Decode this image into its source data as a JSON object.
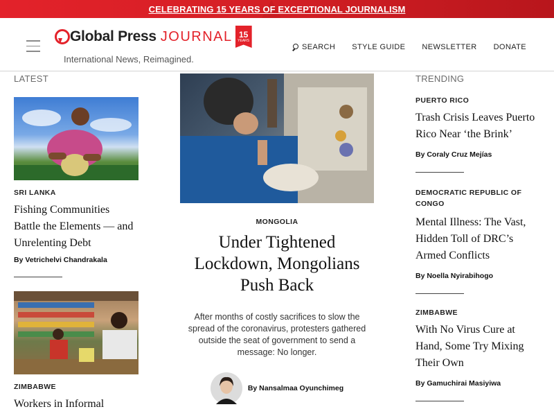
{
  "banner": {
    "text": "CELEBRATING 15 YEARS OF EXCEPTIONAL JOURNALISM"
  },
  "header": {
    "logo_name": "Global Press",
    "logo_journal": "JOURNAL",
    "logo_badge_number": "15",
    "logo_badge_text": "YEARS",
    "tagline": "International News, Reimagined.",
    "nav": {
      "search": "SEARCH",
      "style_guide": "STYLE GUIDE",
      "newsletter": "NEWSLETTER",
      "donate": "DONATE"
    }
  },
  "latest": {
    "label": "LATEST",
    "articles": [
      {
        "kicker": "SRI LANKA",
        "title": "Fishing Communities Battle the Elements — and Unrelenting Debt",
        "byline": "By Vetrichelvi Chandrakala"
      },
      {
        "kicker": "ZIMBABWE",
        "title": "Workers in Informal",
        "byline": ""
      }
    ]
  },
  "featured": {
    "kicker": "MONGOLIA",
    "title": "Under Tightened Lockdown, Mongolians Push Back",
    "summary": "After months of costly sacrifices to slow the spread of the coronavirus, protesters gathered outside the seat of government to send a message: No longer.",
    "byline": "By Nansalmaa Oyunchimeg"
  },
  "trending": {
    "label": "TRENDING",
    "articles": [
      {
        "kicker": "PUERTO RICO",
        "title": "Trash Crisis Leaves Puerto Rico Near ‘the Brink’",
        "byline": "By Coraly Cruz Mejías"
      },
      {
        "kicker": "DEMOCRATIC REPUBLIC OF CONGO",
        "title": "Mental Illness: The Vast, Hidden Toll of DRC’s Armed Conflicts",
        "byline": "By Noella Nyirabihogo"
      },
      {
        "kicker": "ZIMBABWE",
        "title": "With No Virus Cure at Hand, Some Try Mixing Their Own",
        "byline": "By Gamuchirai Masiyiwa"
      }
    ]
  },
  "colors": {
    "brand_red": "#e3222a",
    "text": "#111111",
    "muted": "#6b6b6b"
  },
  "icons": [
    "menu-icon",
    "search-icon",
    "logo-pin-icon"
  ]
}
